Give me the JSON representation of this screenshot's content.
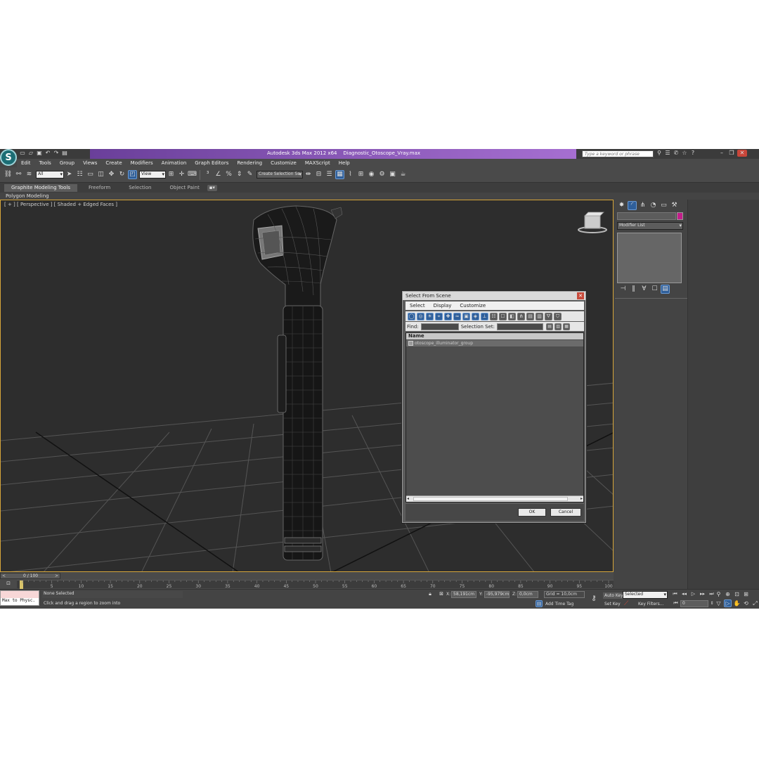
{
  "title": {
    "app": "Autodesk 3ds Max  2012 x64",
    "file": "Diagnostic_Otoscope_Vray.max",
    "search_placeholder": "Type a keyword or phrase"
  },
  "menu": [
    "Edit",
    "Tools",
    "Group",
    "Views",
    "Create",
    "Modifiers",
    "Animation",
    "Graph Editors",
    "Rendering",
    "Customize",
    "MAXScript",
    "Help"
  ],
  "main_toolbar": {
    "filter_select": "All",
    "reference_coord": "View",
    "named_selection_set": "Create Selection Se"
  },
  "ribbon": {
    "tabs": [
      "Graphite Modeling Tools",
      "Freeform",
      "Selection",
      "Object Paint"
    ],
    "sub_label": "Polygon Modeling"
  },
  "viewport": {
    "label": "[ + ] [ Perspective ] [ Shaded + Edged Faces ]"
  },
  "command_panel": {
    "modifier_list": "Modifier List",
    "color_swatch": "#c21e8a"
  },
  "dialog": {
    "title": "Select From Scene",
    "menu": [
      "Select",
      "Display",
      "Customize"
    ],
    "find_label": "Find:",
    "selection_set_label": "Selection Set:",
    "column_name": "Name",
    "items": [
      "otoscope_illuminator_group"
    ],
    "ok_label": "OK",
    "cancel_label": "Cancel"
  },
  "timeline": {
    "frame_counter": "0 / 100",
    "ticks": [
      "0",
      "5",
      "10",
      "15",
      "20",
      "25",
      "30",
      "35",
      "40",
      "45",
      "50",
      "55",
      "60",
      "65",
      "70",
      "75",
      "80",
      "85",
      "90",
      "95",
      "100"
    ]
  },
  "status": {
    "script_listener": "Max to Physc.",
    "selection": "None Selected",
    "prompt": "Click and drag a region to zoom into",
    "x_label": "X:",
    "x_value": "58,191cm",
    "y_label": "Y:",
    "y_value": "-95,979cm",
    "z_label": "Z:",
    "z_value": "0,0cm",
    "grid": "Grid = 10,0cm",
    "add_time_tag": "Add Time Tag",
    "auto_key": "Auto Key",
    "set_key": "Set Key",
    "key_mode": "Selected",
    "key_filters": "Key Filters...",
    "current_frame": "0"
  }
}
